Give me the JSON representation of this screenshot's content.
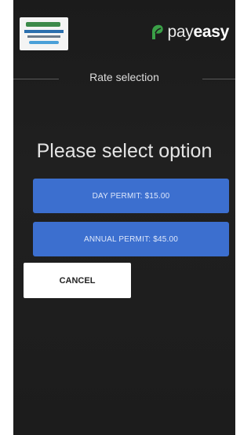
{
  "header": {
    "left_logo_icon": "organization-logo",
    "brand_icon": "payeasy-leaf-icon",
    "brand_name_light": "pay",
    "brand_name_bold": "easy",
    "brand_color": "#3aa047"
  },
  "section": {
    "title": "Rate selection"
  },
  "prompt": "Please select option",
  "options": [
    {
      "label": "DAY PERMIT: $15.00"
    },
    {
      "label": "ANNUAL PERMIT: $45.00"
    }
  ],
  "cancel_label": "CANCEL",
  "colors": {
    "background": "#1e1e1e",
    "option_button": "#3c6fcf",
    "cancel_button": "#ffffff"
  }
}
